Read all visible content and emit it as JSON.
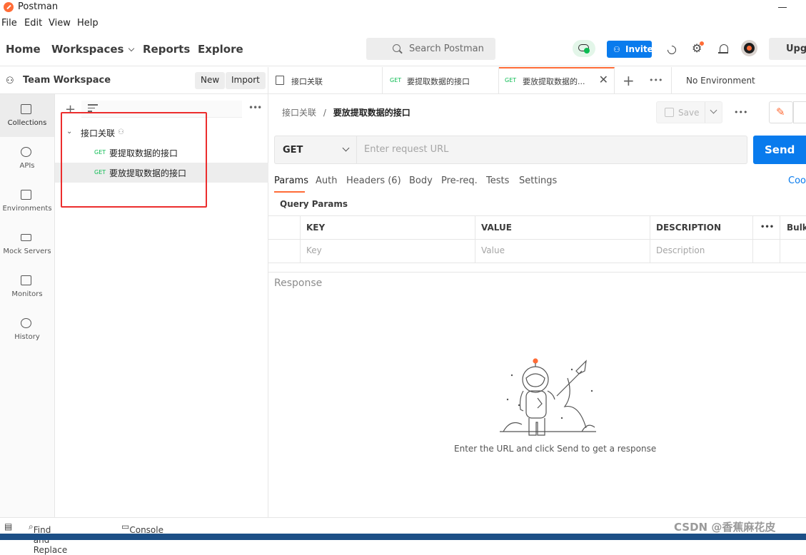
{
  "window": {
    "title": "Postman"
  },
  "menu": [
    "File",
    "Edit",
    "View",
    "Help"
  ],
  "header": {
    "nav": {
      "home": "Home",
      "workspaces": "Workspaces",
      "reports": "Reports",
      "explore": "Explore"
    },
    "search_placeholder": "Search Postman",
    "invite_label": "Invite",
    "upgrade_label": "Upgr"
  },
  "workspace": {
    "name": "Team Workspace",
    "new_label": "New",
    "import_label": "Import"
  },
  "rail": [
    {
      "label": "Collections",
      "icon": "collections-icon"
    },
    {
      "label": "APIs",
      "icon": "apis-icon"
    },
    {
      "label": "Environments",
      "icon": "environments-icon"
    },
    {
      "label": "Mock Servers",
      "icon": "mock-servers-icon"
    },
    {
      "label": "Monitors",
      "icon": "monitors-icon"
    },
    {
      "label": "History",
      "icon": "history-icon"
    }
  ],
  "collection": {
    "name": "接口关联",
    "requests": [
      {
        "method": "GET",
        "name": "要提取数据的接口"
      },
      {
        "method": "GET",
        "name": "要放提取数据的接口"
      }
    ]
  },
  "tabs": [
    {
      "label": "接口关联"
    },
    {
      "method": "GET",
      "label": "要提取数据的接口"
    },
    {
      "method": "GET",
      "label": "要放提取数据的..."
    }
  ],
  "environment": "No Environment",
  "request": {
    "breadcrumb_parent": "接口关联",
    "breadcrumb_sep": "/",
    "breadcrumb_current": "要放提取数据的接口",
    "save_label": "Save",
    "method": "GET",
    "url_placeholder": "Enter request URL",
    "send_label": "Send",
    "subtabs": [
      "Params",
      "Auth",
      "Headers (6)",
      "Body",
      "Pre-req.",
      "Tests",
      "Settings"
    ],
    "cookies_label": "Cool",
    "query_params_title": "Query Params",
    "table": {
      "headers": [
        "KEY",
        "VALUE",
        "DESCRIPTION"
      ],
      "bulk_label": "Bulk",
      "placeholders": [
        "Key",
        "Value",
        "Description"
      ]
    }
  },
  "response": {
    "title": "Response",
    "empty_message": "Enter the URL and click Send to get a response"
  },
  "statusbar": {
    "find_replace": "Find and Replace",
    "console": "Console",
    "watermark": "CSDN @香蕉麻花皮"
  }
}
